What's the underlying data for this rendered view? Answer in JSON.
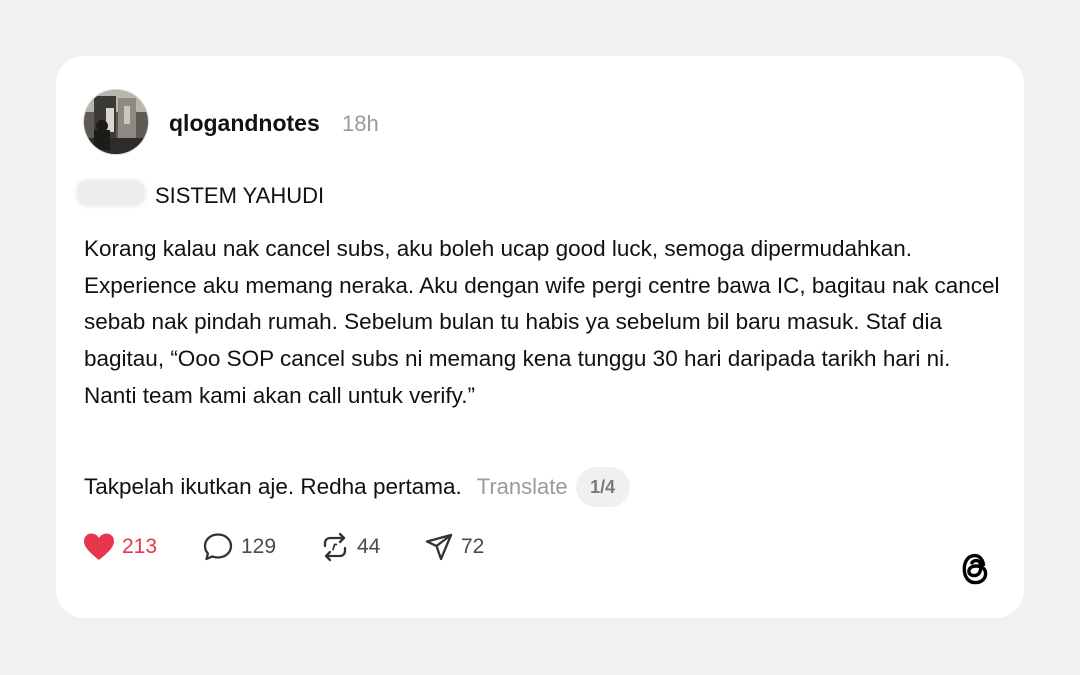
{
  "post": {
    "username": "qlogandnotes",
    "timestamp": "18h",
    "topic": "SISTEM YAHUDI",
    "body_paragraph": "Korang kalau nak cancel subs, aku boleh ucap good luck, semoga dipermudahkan. Experience aku memang neraka. Aku dengan wife pergi centre bawa IC, bagitau nak cancel sebab nak pindah rumah. Sebelum bulan tu habis ya sebelum bil baru masuk. Staf dia bagitau, “Ooo SOP cancel subs ni memang kena tunggu 30 hari daripada tarikh hari ni. Nanti team kami akan call untuk verify.”",
    "closing_line": "Takpelah ikutkan aje. Redha pertama.",
    "translate_label": "Translate",
    "thread_position": "1/4"
  },
  "actions": {
    "likes": "213",
    "comments": "129",
    "reposts": "44",
    "shares": "72",
    "liked": true
  },
  "colors": {
    "background": "#f1f1f1",
    "card": "#ffffff",
    "like_red": "#e5364b",
    "muted_text": "#9a9a9a"
  },
  "icons": {
    "like": "heart-icon",
    "comment": "comment-bubble-icon",
    "repost": "repost-icon",
    "share": "send-icon",
    "brand": "threads-logo-icon"
  }
}
